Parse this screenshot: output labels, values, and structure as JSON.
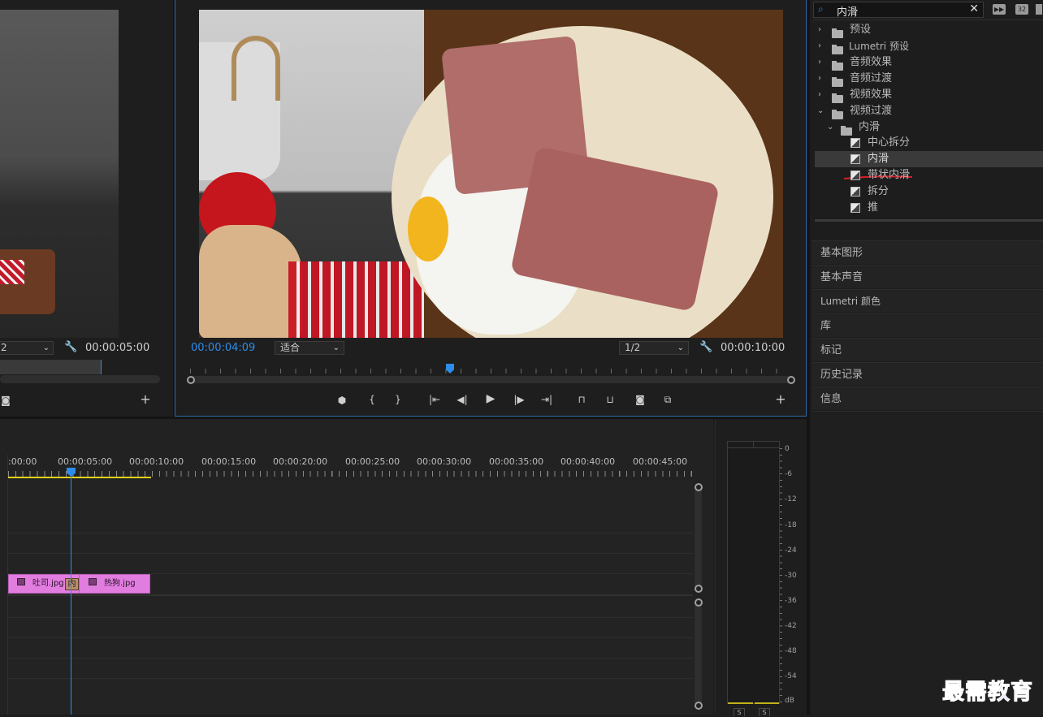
{
  "source_monitor": {
    "timecode_end": "00:00:05:00",
    "zoom_value": "2"
  },
  "program_monitor": {
    "timecode_current": "00:00:04:09",
    "fit_label": "适合",
    "resolution_label": "1/2",
    "timecode_duration": "00:00:10:00"
  },
  "effects_panel": {
    "search_value": "内滑",
    "tree": [
      {
        "label": "预设",
        "type": "preset-folder"
      },
      {
        "label": "Lumetri 预设",
        "type": "preset-folder"
      },
      {
        "label": "音频效果",
        "type": "folder"
      },
      {
        "label": "音频过渡",
        "type": "folder"
      },
      {
        "label": "视频效果",
        "type": "folder"
      },
      {
        "label": "视频过渡",
        "type": "folder",
        "expanded": true
      },
      {
        "label": "内滑",
        "type": "folder",
        "expanded": true
      },
      {
        "label": "中心拆分",
        "type": "effect"
      },
      {
        "label": "内滑",
        "type": "effect",
        "selected": true
      },
      {
        "label": "带状内滑",
        "type": "effect"
      },
      {
        "label": "拆分",
        "type": "effect"
      },
      {
        "label": "推",
        "type": "effect"
      }
    ]
  },
  "side_panels": [
    "基本图形",
    "基本声音",
    "Lumetri 颜色",
    "库",
    "标记",
    "历史记录",
    "信息"
  ],
  "timeline": {
    "ruler_labels": [
      ":00:00",
      "00:00:05:00",
      "00:00:10:00",
      "00:00:15:00",
      "00:00:20:00",
      "00:00:25:00",
      "00:00:30:00",
      "00:00:35:00",
      "00:00:40:00",
      "00:00:45:00"
    ],
    "clips": [
      {
        "name": "吐司.jpg"
      },
      {
        "name": "热狗.jpg"
      }
    ],
    "transition_label": "内"
  },
  "audio_meter": {
    "scale": [
      "0",
      "-6",
      "-12",
      "-18",
      "-24",
      "-30",
      "-36",
      "-42",
      "-48",
      "-54",
      "dB"
    ],
    "channels": [
      "S",
      "S"
    ]
  },
  "watermark": "最需教育",
  "colors": {
    "accent_blue": "#2d8ceb",
    "clip_pink": "#e27de0",
    "work_area_yellow": "#e0d21c",
    "annotation_red": "#d3202a"
  }
}
